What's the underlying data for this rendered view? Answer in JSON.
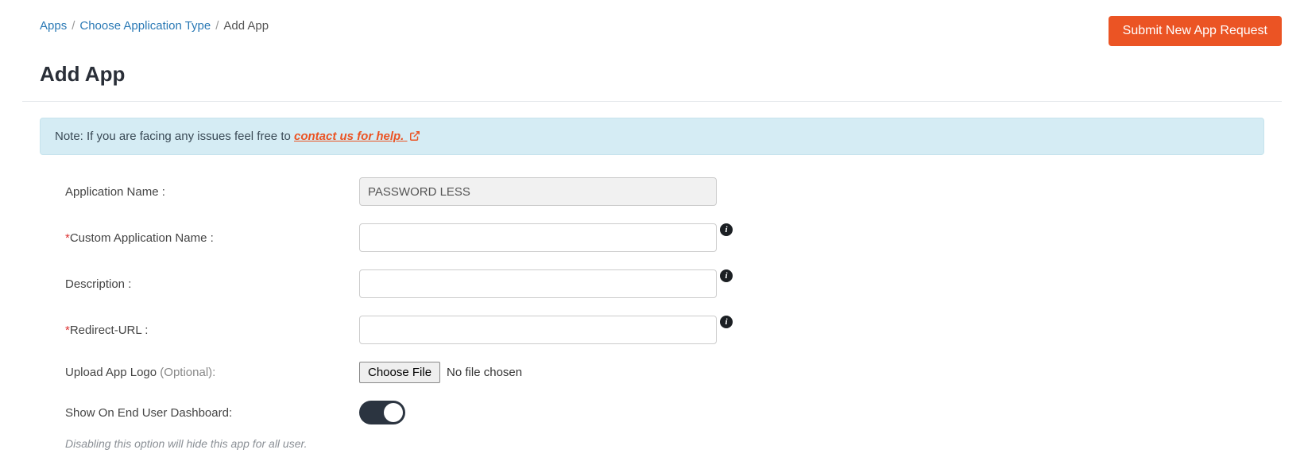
{
  "breadcrumb": {
    "items": [
      "Apps",
      "Choose Application Type"
    ],
    "current": "Add App"
  },
  "header": {
    "title": "Add App",
    "submit_button": "Submit New App Request"
  },
  "alert": {
    "prefix": "Note: If you are facing any issues feel free to ",
    "link_text": "contact us for help."
  },
  "form": {
    "app_name_label": "Application Name :",
    "app_name_value": "PASSWORD LESS",
    "custom_name_label": "Custom Application Name :",
    "custom_name_value": "",
    "description_label": "Description :",
    "description_value": "",
    "redirect_label": "Redirect-URL :",
    "redirect_value": "",
    "upload_label": "Upload App Logo ",
    "upload_optional": "(Optional):",
    "choose_file_label": "Choose File",
    "file_status": "No file chosen",
    "show_dashboard_label": "Show On End User Dashboard:",
    "helper_text": "Disabling this option will hide this app for all user."
  }
}
